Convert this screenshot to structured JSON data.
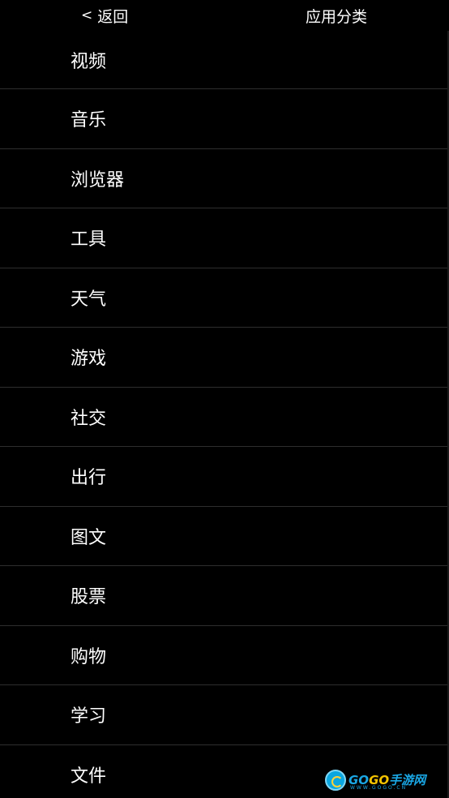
{
  "header": {
    "back_label": "返回",
    "back_chevron": "<",
    "title": "应用分类"
  },
  "categories": [
    {
      "label": "视频"
    },
    {
      "label": "音乐"
    },
    {
      "label": "浏览器"
    },
    {
      "label": "工具"
    },
    {
      "label": "天气"
    },
    {
      "label": "游戏"
    },
    {
      "label": "社交"
    },
    {
      "label": "出行"
    },
    {
      "label": "图文"
    },
    {
      "label": "股票"
    },
    {
      "label": "购物"
    },
    {
      "label": "学习"
    },
    {
      "label": "文件"
    }
  ],
  "watermark": {
    "part1": "GO",
    "part2": "GO",
    "part3": "手游网",
    "url": "WWW.GOGO.CN"
  },
  "colors": {
    "background": "#000000",
    "text": "#ffffff",
    "divider": "#2e2e2e"
  }
}
